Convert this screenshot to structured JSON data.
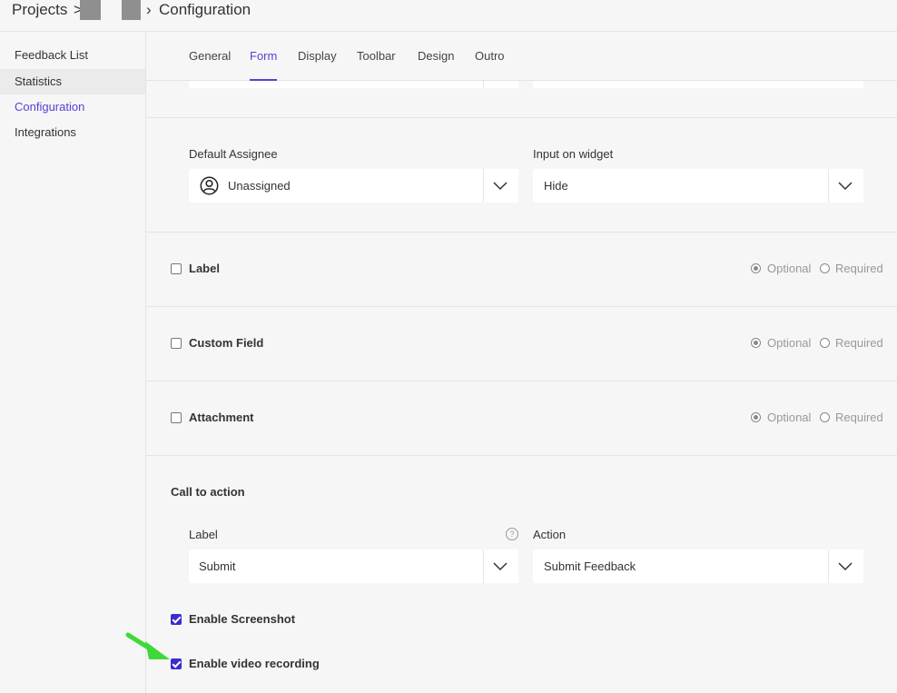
{
  "breadcrumb": {
    "projects": "Projects",
    "sep1": ">",
    "sep2": "›",
    "current": "Configuration"
  },
  "sidebar": {
    "items": [
      {
        "label": "Feedback List"
      },
      {
        "label": "Statistics"
      },
      {
        "label": "Configuration"
      },
      {
        "label": "Integrations"
      }
    ]
  },
  "tabs": [
    {
      "label": "General"
    },
    {
      "label": "Form"
    },
    {
      "label": "Display"
    },
    {
      "label": "Toolbar"
    },
    {
      "label": "Design"
    },
    {
      "label": "Outro"
    }
  ],
  "assignee": {
    "label": "Default Assignee",
    "value": "Unassigned"
  },
  "input_on_widget": {
    "label": "Input on widget",
    "value": "Hide"
  },
  "fields": [
    {
      "label": "Label",
      "optional": "Optional",
      "required": "Required",
      "checked": false
    },
    {
      "label": "Custom Field",
      "optional": "Optional",
      "required": "Required",
      "checked": false
    },
    {
      "label": "Attachment",
      "optional": "Optional",
      "required": "Required",
      "checked": false
    }
  ],
  "cta": {
    "heading": "Call to action",
    "label_title": "Label",
    "help": "?",
    "label_value": "Submit",
    "action_title": "Action",
    "action_value": "Submit Feedback"
  },
  "options": {
    "screenshot": "Enable Screenshot",
    "video": "Enable video recording"
  },
  "colors": {
    "accent": "#5b3ed6",
    "checkbox": "#3d2bd1",
    "arrow": "#3fd83a"
  },
  "icons": [
    "user-circle-icon",
    "chevron-down-icon",
    "help-icon",
    "check-icon",
    "arrow-pointer-icon"
  ]
}
